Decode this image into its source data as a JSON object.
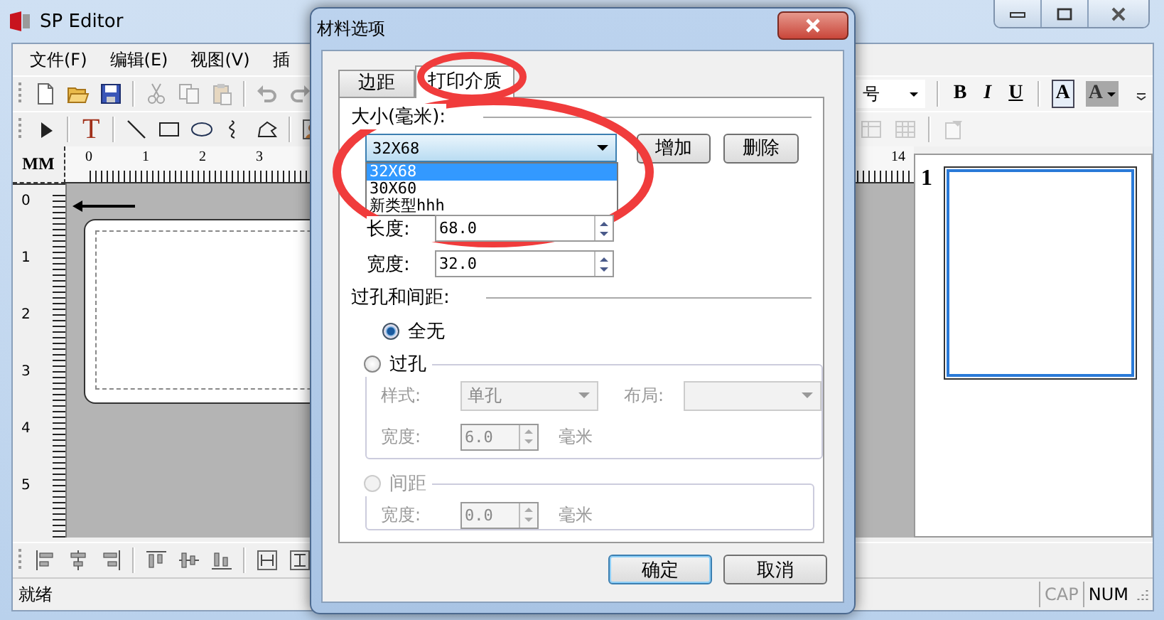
{
  "window": {
    "title": "SP Editor"
  },
  "menu": [
    {
      "label": "文件(F)"
    },
    {
      "label": "编辑(E)"
    },
    {
      "label": "视图(V)"
    },
    {
      "label": "插"
    }
  ],
  "toolbar_top_left": [
    {
      "kind": "new",
      "disabled": false
    },
    {
      "kind": "open",
      "disabled": false
    },
    {
      "kind": "save",
      "disabled": false
    },
    {
      "kind": "separator"
    },
    {
      "kind": "cut",
      "disabled": true
    },
    {
      "kind": "copy",
      "disabled": true
    },
    {
      "kind": "paste",
      "disabled": true
    },
    {
      "kind": "separator"
    },
    {
      "kind": "undo",
      "disabled": true
    },
    {
      "kind": "redo",
      "disabled": true
    }
  ],
  "toolbar_top_right": [
    {
      "kind": "font-size",
      "label": "号"
    },
    {
      "kind": "separator"
    },
    {
      "kind": "bold",
      "label": "B",
      "disabled": false
    },
    {
      "kind": "italic",
      "label": "I",
      "disabled": false
    },
    {
      "kind": "underline",
      "label": "U",
      "disabled": false
    },
    {
      "kind": "separator"
    },
    {
      "kind": "font-color",
      "label": "A",
      "disabled": false
    },
    {
      "kind": "highlight",
      "label": "A",
      "disabled": false
    }
  ],
  "toolbar_draw_left": [
    {
      "kind": "pointer",
      "disabled": false
    },
    {
      "kind": "separator"
    },
    {
      "kind": "text-tool",
      "label": "T",
      "disabled": false
    },
    {
      "kind": "separator"
    },
    {
      "kind": "line",
      "disabled": false
    },
    {
      "kind": "rect",
      "disabled": false
    },
    {
      "kind": "ellipse",
      "disabled": false
    },
    {
      "kind": "curve",
      "disabled": false
    },
    {
      "kind": "polygon",
      "disabled": false
    },
    {
      "kind": "separator"
    },
    {
      "kind": "image",
      "disabled": false
    }
  ],
  "toolbar_draw_right": [
    {
      "kind": "table",
      "disabled": true
    },
    {
      "kind": "grid",
      "disabled": true
    },
    {
      "kind": "separator"
    },
    {
      "kind": "properties",
      "disabled": true
    }
  ],
  "toolbar_align": [
    {
      "kind": "align-left",
      "disabled": false
    },
    {
      "kind": "align-center",
      "disabled": false
    },
    {
      "kind": "align-right",
      "disabled": false
    },
    {
      "kind": "separator"
    },
    {
      "kind": "align-top",
      "disabled": false
    },
    {
      "kind": "align-middle",
      "disabled": false
    },
    {
      "kind": "align-bottom",
      "disabled": false
    },
    {
      "kind": "separator"
    },
    {
      "kind": "same-width",
      "disabled": false
    },
    {
      "kind": "same-height",
      "disabled": false
    }
  ],
  "rulers": {
    "unit": "MM",
    "top_labels": [
      "0",
      "1",
      "2",
      "3",
      "14"
    ],
    "left_labels": [
      "0",
      "1",
      "2",
      "3",
      "4",
      "5"
    ]
  },
  "thumbnails": [
    {
      "label": "1",
      "selected": true
    }
  ],
  "status_bar": {
    "text": "就绪",
    "indicators": [
      {
        "label": "CAP",
        "on": false
      },
      {
        "label": "NUM",
        "on": true
      }
    ]
  },
  "dialog": {
    "title": "材料选项",
    "tabs": [
      {
        "label": "边距",
        "selected": false
      },
      {
        "label": "打印介质",
        "selected": true
      }
    ],
    "size_section": {
      "heading": "大小(毫米):",
      "combo": {
        "value": "32X68",
        "expanded": true
      },
      "options": [
        {
          "label": "32X68",
          "selected": true
        },
        {
          "label": "30X60",
          "selected": false
        },
        {
          "label": "新类型hhh",
          "selected": false
        }
      ],
      "buttons": [
        "增加",
        "删除"
      ],
      "fields": [
        {
          "label": "长度:",
          "value": "68.0"
        },
        {
          "label": "宽度:",
          "value": "32.0"
        }
      ]
    },
    "holes_section": {
      "heading": "过孔和间距:",
      "none_option": {
        "label": "全无",
        "selected": true,
        "disabled": false
      },
      "hole_group": {
        "label": "过孔",
        "selected": false,
        "disabled": false,
        "fields_disabled": true,
        "style_label": "样式:",
        "style_value": "单孔",
        "layout_label": "布局:",
        "width_label": "宽度:",
        "width_value": "6.0",
        "unit": "毫米"
      },
      "gap_group": {
        "label": "间距",
        "selected": false,
        "disabled": true,
        "fields_disabled": true,
        "width_label": "宽度:",
        "width_value": "0.0",
        "unit": "毫米"
      }
    },
    "footer_buttons": [
      {
        "label": "确定",
        "default": true
      },
      {
        "label": "取消",
        "default": false
      }
    ]
  }
}
